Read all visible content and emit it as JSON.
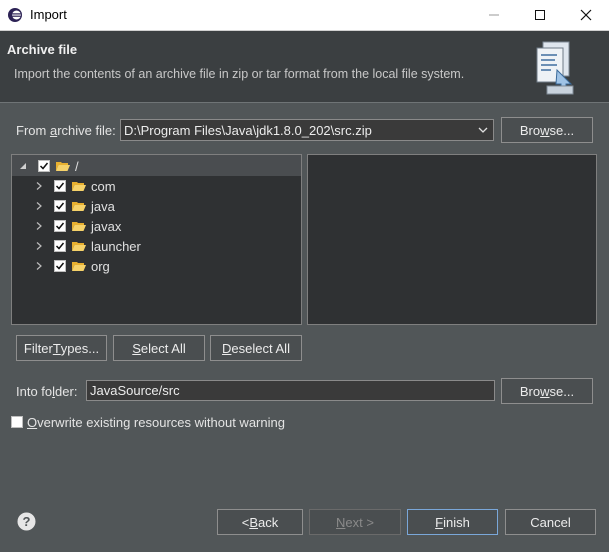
{
  "window": {
    "title": "Import",
    "minimize_icon": "minimize-icon",
    "maximize_icon": "maximize-icon",
    "close_icon": "close-icon"
  },
  "header": {
    "title": "Archive file",
    "description": "Import the contents of an archive file in zip or tar format from the local file system.",
    "icon": "archive-import-wizard-icon"
  },
  "archive": {
    "label_pre": "From ",
    "label_mnemonic": "a",
    "label_post": "rchive file:",
    "value": "D:\\Program Files\\Java\\jdk1.8.0_202\\src.zip",
    "browse_pre": "Bro",
    "browse_mnemonic": "w",
    "browse_post": "se..."
  },
  "tree": {
    "root": {
      "label": "/",
      "checked": true,
      "expanded": true
    },
    "children": [
      {
        "label": "com",
        "checked": true
      },
      {
        "label": "java",
        "checked": true
      },
      {
        "label": "javax",
        "checked": true
      },
      {
        "label": "launcher",
        "checked": true
      },
      {
        "label": "org",
        "checked": true
      }
    ]
  },
  "selection_buttons": {
    "filter_pre": "Filter ",
    "filter_mnemonic": "T",
    "filter_post": "ypes...",
    "select_mnemonic": "S",
    "select_post": "elect All",
    "deselect_mnemonic": "D",
    "deselect_post": "eselect All"
  },
  "into_folder": {
    "label_pre": "Into fo",
    "label_mnemonic": "l",
    "label_post": "der:",
    "value": "JavaSource/src",
    "browse_pre": "Bro",
    "browse_mnemonic": "w",
    "browse_post": "se..."
  },
  "overwrite": {
    "checked": false,
    "label_mnemonic": "O",
    "label_post": "verwrite existing resources without warning"
  },
  "footer": {
    "help_icon": "help-icon",
    "back_pre": "< ",
    "back_mnemonic": "B",
    "back_post": "ack",
    "next_mnemonic": "N",
    "next_post": "ext >",
    "finish_mnemonic": "F",
    "finish_post": "inish",
    "cancel": "Cancel"
  },
  "colors": {
    "background": "#515658",
    "header_background": "#3b3f41",
    "tree_background": "#2f3133",
    "folder": "#f0c040",
    "default_button_border": "#7aa7d9"
  }
}
